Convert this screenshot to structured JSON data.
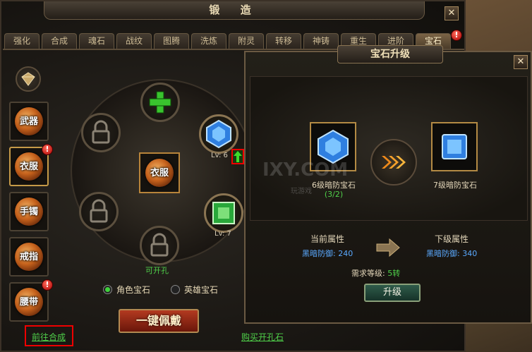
{
  "window": {
    "title": "锻 造",
    "close": "✕"
  },
  "tabs": [
    "强化",
    "合成",
    "魂石",
    "战纹",
    "图腾",
    "洗炼",
    "附灵",
    "转移",
    "神铸",
    "重生",
    "进阶",
    "宝石"
  ],
  "active_tab": "宝石",
  "sidebar": {
    "items": [
      {
        "label": "武器",
        "alert": false
      },
      {
        "label": "衣服",
        "alert": true
      },
      {
        "label": "手镯",
        "alert": false
      },
      {
        "label": "戒指",
        "alert": false
      },
      {
        "label": "腰带",
        "alert": true
      }
    ],
    "alert_mark": "!"
  },
  "wheel": {
    "center_label": "衣服",
    "gem_top_level": "Lv: 6",
    "gem_bottom_level": "Lv: 7",
    "openable_label": "可开孔"
  },
  "radios": {
    "role_gem": "角色宝石",
    "hero_gem": "英雄宝石"
  },
  "buttons": {
    "equip_all": "一键佩戴",
    "upgrade": "升级"
  },
  "links": {
    "goto_compose": "前往合成",
    "buy_socket_stone": "购买开孔石"
  },
  "upgrade_panel": {
    "title": "宝石升级",
    "current_gem": "6级暗防宝石",
    "current_count": "(3/2)",
    "next_gem": "7级暗防宝石",
    "current_attr_header": "当前属性",
    "next_attr_header": "下级属性",
    "current_attr": "黑暗防御: 240",
    "next_attr": "黑暗防御: 340",
    "requirement_label": "需求等级:",
    "requirement_value": "5转",
    "close": "✕"
  },
  "watermark": {
    "main": "IXY.COM",
    "sub": "玩游戏"
  },
  "colors": {
    "accent_gold": "#b38a44",
    "link_green": "#4fd04a",
    "attr_blue": "#5aa9ff",
    "alert_red": "#e00000"
  }
}
